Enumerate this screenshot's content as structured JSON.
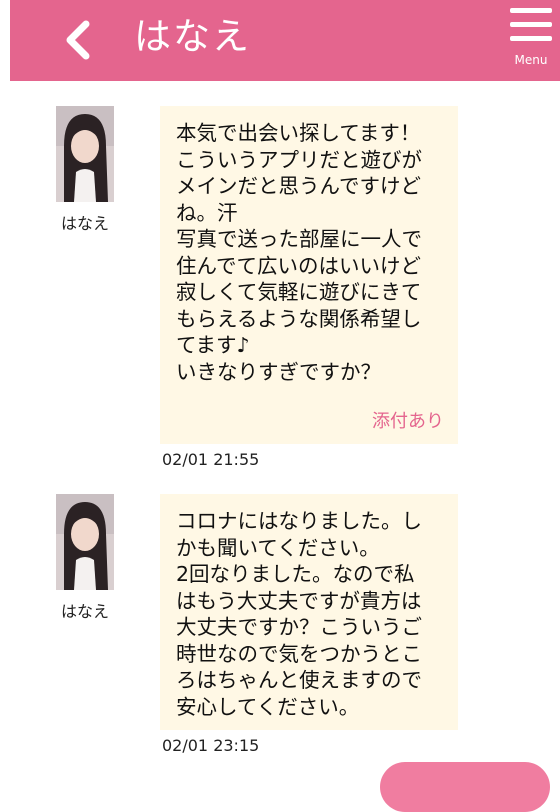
{
  "header": {
    "title": "はなえ",
    "menu_label": "Menu",
    "accent_color": "#e4658e"
  },
  "messages": [
    {
      "sender": "はなえ",
      "text": "本気で出会い探してます！\nこういうアプリだと遊びが\nメインだと思うんですけど\nね。汗\n写真で送った部屋に一人で\n住んでて広いのはいいけど\n寂しくて気軽に遊びにきて\nもらえるような関係希望し\nてます♪\nいきなりすぎですか？",
      "attachment_label": "添付あり",
      "time": "02/01 21:55"
    },
    {
      "sender": "はなえ",
      "text": "コロナにはなりました。し\nかも聞いてください。\n2回なりました。なので私\nはもう大丈夫ですが貴方は\n大丈夫ですか？こういうご\n時世なので気をつかうとこ\nろはちゃんと使えますので\n安心してください。",
      "time": "02/01 23:15"
    }
  ]
}
